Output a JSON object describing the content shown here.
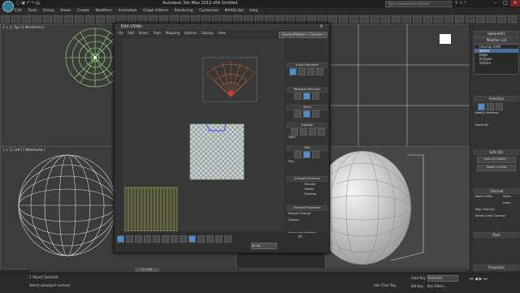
{
  "app": {
    "title": "Autodesk 3ds Max 2012 x64     Untitled",
    "search_placeholder": "Type a keyword or phrase",
    "menu": [
      "Edit",
      "Tools",
      "Group",
      "Views",
      "Create",
      "Modifiers",
      "Animation",
      "Graph Editors",
      "Rendering",
      "Customize",
      "MAXScript",
      "Help"
    ]
  },
  "viewports": {
    "top_left": "[ + ] [ Top ] [ Wireframe ]",
    "bottom_left": "[ + ] [ Left ] [ Wireframe ]"
  },
  "uvw_editor": {
    "title": "Edit UVWs",
    "menu": [
      "File",
      "Edit",
      "Select",
      "Tools",
      "Mapping",
      "Options",
      "Display",
      "View"
    ],
    "texture_dropdown": "CheckerPattern ( Checker )",
    "rollouts": [
      "Quick Transform",
      "Reshape Elements",
      "Stitch",
      "Explode",
      "Peel",
      "Arrange Elements",
      "Element Properties"
    ],
    "peel_labels": [
      "Weld",
      "Pins"
    ],
    "arrange_options": [
      "Rescale",
      "Rotate",
      "Padding"
    ],
    "element_props": {
      "rescale_priority": "Rescale Priority:",
      "groups": "Groups:",
      "no_groups": "No groups selected"
    },
    "bottom": {
      "all_ids": "All IDs",
      "coords": "XY"
    }
  },
  "right_panel": {
    "object_name": "Sphere001",
    "modifier_list": "Modifier List",
    "stack": [
      {
        "label": "Unwrap UVW",
        "selected": false
      },
      {
        "label": "Vertex",
        "selected": true
      },
      {
        "label": "Edge",
        "selected": false
      },
      {
        "label": "Polygon",
        "selected": false
      },
      {
        "label": "Sphere",
        "selected": false
      }
    ],
    "sections": {
      "selection": "Selection",
      "modify_selection": "Modify Selection",
      "select_by": "Select By",
      "edit_uvs": "Edit UVs",
      "open_uv_editor": "Open UV Editor ...",
      "tweak": "Tweak In View",
      "channel": "Channel",
      "reset_uvws": "Reset UVWs",
      "save": "Save...",
      "load": "Load...",
      "map_channel": "Map Channel:",
      "vertex_color_channel": "Vertex Color Channel",
      "peel": "Peel",
      "projection": "Projection"
    }
  },
  "timeline": {
    "frame": "0 / 100"
  },
  "status": {
    "selected": "1 Object Selected",
    "hint": "Select subobject vertices",
    "add_time_tag": "Add Time Tag",
    "auto_key": "Auto Key",
    "selected_dropdown": "Selected",
    "set_key": "Set Key",
    "key_filters": "Key Filters..."
  }
}
